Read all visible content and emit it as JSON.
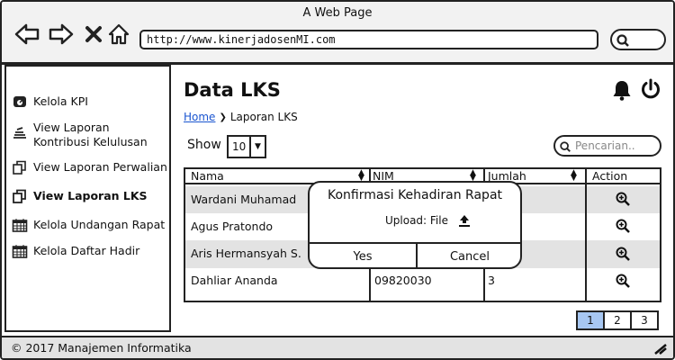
{
  "browser": {
    "title": "A Web Page",
    "url": "http://www.kinerjadosenMI.com"
  },
  "sidebar": {
    "items": [
      {
        "label": "Kelola KPI",
        "icon": "dashboard-icon"
      },
      {
        "label": "View Laporan\nKontribusi Kelulusan",
        "icon": "stack-icon"
      },
      {
        "label": "View Laporan Perwalian",
        "icon": "copy-icon"
      },
      {
        "label": "View Laporan LKS",
        "icon": "copy-icon"
      },
      {
        "label": "Kelola Undangan Rapat",
        "icon": "calendar-icon"
      },
      {
        "label": "Kelola Daftar Hadir",
        "icon": "calendar-icon"
      }
    ],
    "active_index": 3
  },
  "main": {
    "title": "Data LKS",
    "breadcrumb": {
      "home": "Home",
      "current": "Laporan LKS"
    },
    "show_label": "Show",
    "show_value": "10",
    "search_placeholder": "Pencarian.."
  },
  "table": {
    "columns": [
      "Nama",
      "NIM",
      "Jumlah",
      "Action"
    ],
    "rows": [
      {
        "nama": "Wardani Muhamad",
        "nim": "",
        "jumlah": ""
      },
      {
        "nama": "Agus Pratondo",
        "nim": "",
        "jumlah": ""
      },
      {
        "nama": "Aris Hermansyah S.",
        "nim": "",
        "jumlah": ""
      },
      {
        "nama": "Dahliar Ananda",
        "nim": "09820030",
        "jumlah": "3"
      }
    ]
  },
  "dialog": {
    "title": "Konfirmasi Kehadiran Rapat",
    "upload_label": "Upload: File",
    "yes_label": "Yes",
    "cancel_label": "Cancel"
  },
  "pagination": {
    "pages": [
      "1",
      "2",
      "3"
    ],
    "active": "1"
  },
  "footer": {
    "text": "© 2017 Manajemen Informatika"
  },
  "colors": {
    "accent": "#a7c7f2",
    "link": "#1a55d0",
    "row_alt": "#e3e3e3"
  }
}
